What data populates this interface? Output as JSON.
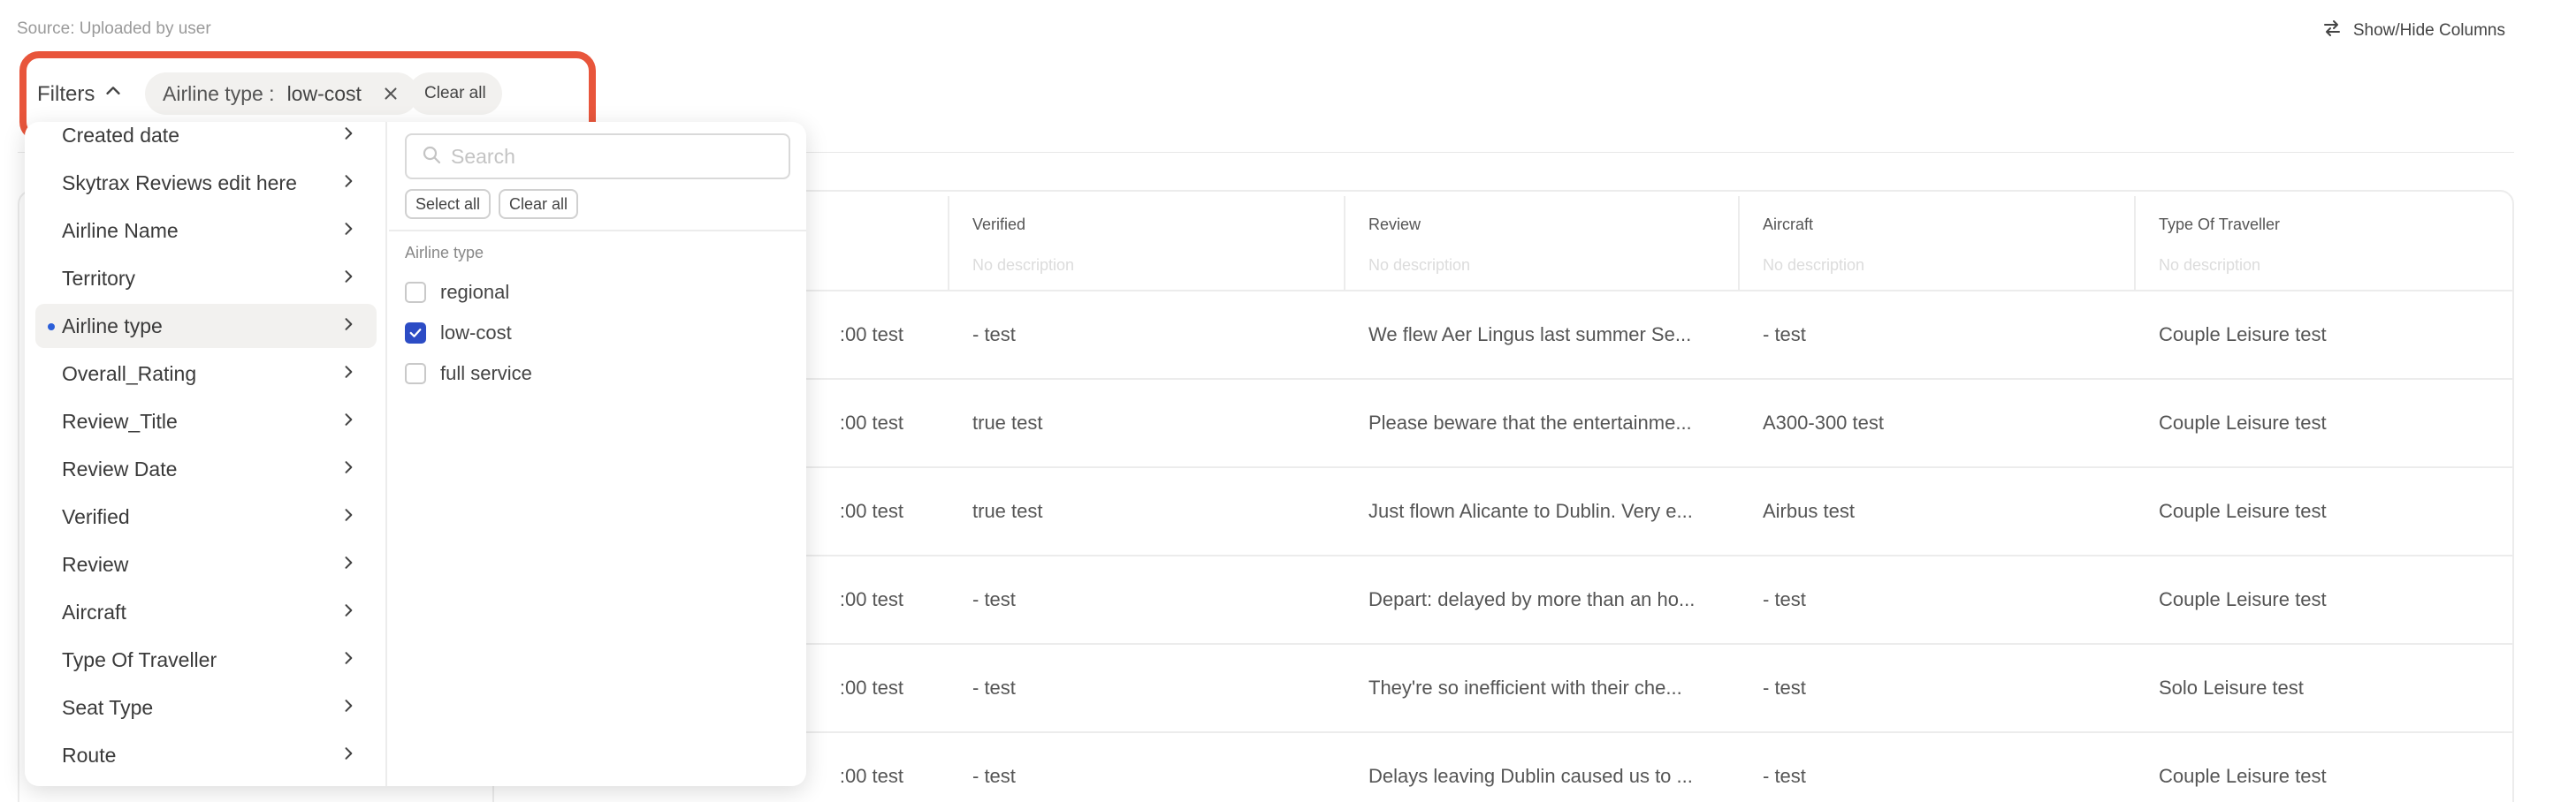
{
  "source_label": "Source: Uploaded by user",
  "toolbar": {
    "show_hide_label": "Show/Hide Columns"
  },
  "filters": {
    "toggle_label": "Filters",
    "chip": {
      "field": "Airline type :",
      "value": "low-cost"
    },
    "clear_all_label": "Clear all",
    "accent_color": "#e8553b"
  },
  "menu": {
    "items": [
      {
        "label": "Created date"
      },
      {
        "label": "Skytrax Reviews edit here"
      },
      {
        "label": "Airline Name"
      },
      {
        "label": "Territory"
      },
      {
        "label": "Airline type"
      },
      {
        "label": "Overall_Rating"
      },
      {
        "label": "Review_Title"
      },
      {
        "label": "Review Date"
      },
      {
        "label": "Verified"
      },
      {
        "label": "Review"
      },
      {
        "label": "Aircraft"
      },
      {
        "label": "Type Of Traveller"
      },
      {
        "label": "Seat Type"
      },
      {
        "label": "Route"
      }
    ],
    "active_index": 4
  },
  "panel": {
    "search_placeholder": "Search",
    "select_all_label": "Select all",
    "clear_all_label": "Clear all",
    "group_label": "Airline type",
    "options": [
      {
        "label": "regional",
        "checked": false
      },
      {
        "label": "low-cost",
        "checked": true
      },
      {
        "label": "full service",
        "checked": false
      }
    ],
    "checkbox_color": "#2c4cc5"
  },
  "table": {
    "columns": [
      {
        "label": "",
        "desc": ""
      },
      {
        "label": "Verified",
        "desc": "No description"
      },
      {
        "label": "Review",
        "desc": "No description"
      },
      {
        "label": "Aircraft",
        "desc": "No description"
      },
      {
        "label": "Type Of Traveller",
        "desc": "No description"
      }
    ],
    "rows": [
      [
        ":00 test",
        "- test",
        "We flew Aer Lingus last summer Se...",
        "- test",
        "Couple Leisure test"
      ],
      [
        ":00 test",
        "true test",
        "Please beware that the entertainme...",
        "A300-300 test",
        "Couple Leisure test"
      ],
      [
        ":00 test",
        "true test",
        "Just flown Alicante to Dublin. Very e...",
        "Airbus test",
        "Couple Leisure test"
      ],
      [
        ":00 test",
        "- test",
        "Depart: delayed by more than an ho...",
        "- test",
        "Couple Leisure test"
      ],
      [
        ":00 test",
        "- test",
        "They're so inefficient with their che...",
        "- test",
        "Solo Leisure test"
      ],
      [
        ":00 test",
        "- test",
        "Delays leaving Dublin caused us to ...",
        "- test",
        "Couple Leisure test"
      ]
    ]
  }
}
